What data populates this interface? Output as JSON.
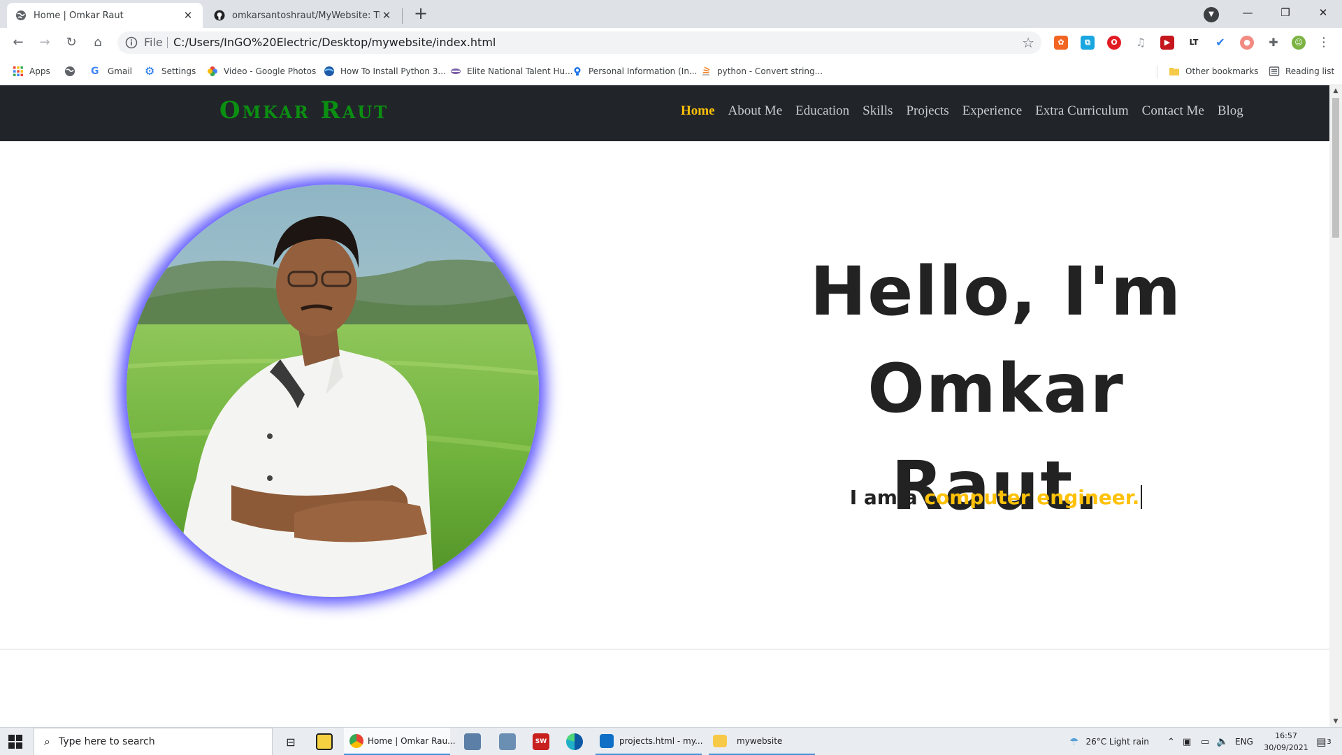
{
  "browser": {
    "tabs": [
      {
        "title": "Home | Omkar Raut",
        "active": true
      },
      {
        "title": "omkarsantoshraut/MyWebsite: This is m",
        "active": false
      }
    ],
    "omnibox": {
      "scheme": "File",
      "url": "C:/Users/InGO%20Electric/Desktop/mywebsite/index.html"
    },
    "bookmarks": [
      {
        "label": "Apps"
      },
      {
        "label": ""
      },
      {
        "label": "Gmail"
      },
      {
        "label": "Settings"
      },
      {
        "label": "Video - Google Photos"
      },
      {
        "label": "How To Install Python 3..."
      },
      {
        "label": "Elite National Talent Hu..."
      },
      {
        "label": "Personal Information (In..."
      },
      {
        "label": "python - Convert string..."
      }
    ],
    "other_bookmarks": "Other bookmarks",
    "reading_list": "Reading list"
  },
  "site": {
    "brand": "Omkar Raut",
    "nav": [
      "Home",
      "About Me",
      "Education",
      "Skills",
      "Projects",
      "Experience",
      "Extra Curriculum",
      "Contact Me",
      "Blog"
    ],
    "active_nav": "Home",
    "headline_line1": "Hello, I'm Omkar",
    "headline_line2": "Raut.",
    "sub_prefix": "I am a",
    "sub_role": "computer engineer."
  },
  "taskbar": {
    "search_placeholder": "Type here to search",
    "items": [
      {
        "label": "Home | Omkar Rau..."
      },
      {
        "label": "projects.html - my..."
      },
      {
        "label": "mywebsite"
      }
    ],
    "weather": "26°C  Light rain",
    "lang": "ENG",
    "time": "16:57",
    "date": "30/09/2021",
    "notifications": "3"
  },
  "colors": {
    "nav_bg": "#212529",
    "brand": "#0b8f12",
    "accent": "#ffc107",
    "photo_glow": "#5b54ff"
  }
}
